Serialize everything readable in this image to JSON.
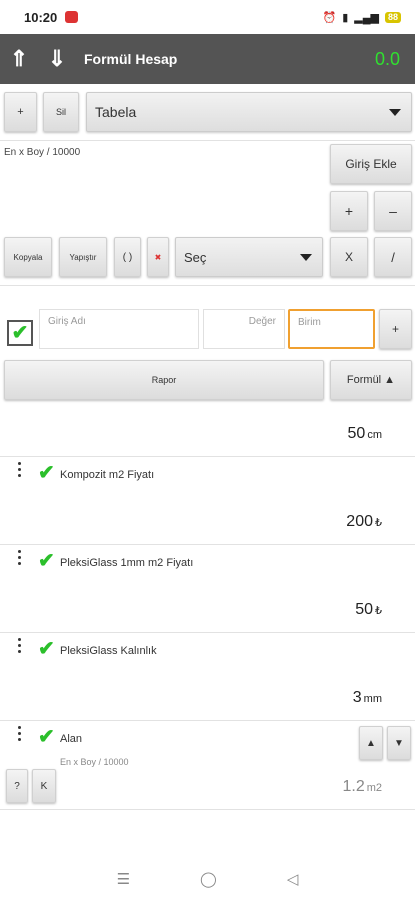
{
  "status": {
    "time": "10:20",
    "battery": "88"
  },
  "appbar": {
    "up_icon": "arrow-up-icon",
    "down_icon": "arrow-down-icon",
    "title": "Formül Hesap",
    "result": "0.0"
  },
  "toolbar": {
    "add_label": "+",
    "delete_label": "Sil",
    "table_select": "Tabela"
  },
  "formula": {
    "expression": "En x Boy / 10000",
    "add_input_label": "Giriş Ekle",
    "copy_label": "Kopyala",
    "paste_label": "Yapıştır",
    "paren_label": "( )",
    "clear_label": "✖",
    "select_label": "Seç",
    "plus_label": "+",
    "minus_label": "–",
    "times_label": "X",
    "divide_label": "/"
  },
  "input_row": {
    "name_placeholder": "Giriş Adı",
    "value_placeholder": "Değer",
    "unit_placeholder": "Birim",
    "add_label": "+"
  },
  "report": {
    "report_label": "Rapor",
    "formula_label": "Formül ▲"
  },
  "items": [
    {
      "label": "",
      "value": "50",
      "unit": "cm"
    },
    {
      "label": "Kompozit m2 Fiyatı",
      "value": "200",
      "unit": "₺"
    },
    {
      "label": "PleksiGlass 1mm m2 Fiyatı",
      "value": "50",
      "unit": "₺"
    },
    {
      "label": "PleksiGlass Kalınlık",
      "value": "3",
      "unit": "mm"
    },
    {
      "label": "Alan",
      "sub": "En x Boy / 10000",
      "value": "1.2",
      "unit": "m2"
    }
  ],
  "alan_buttons": {
    "up": "▲",
    "down": "▼",
    "help": "?",
    "k": "K"
  },
  "navbar": {
    "menu_icon": "menu-icon",
    "home_icon": "home-icon",
    "back_icon": "back-icon"
  }
}
